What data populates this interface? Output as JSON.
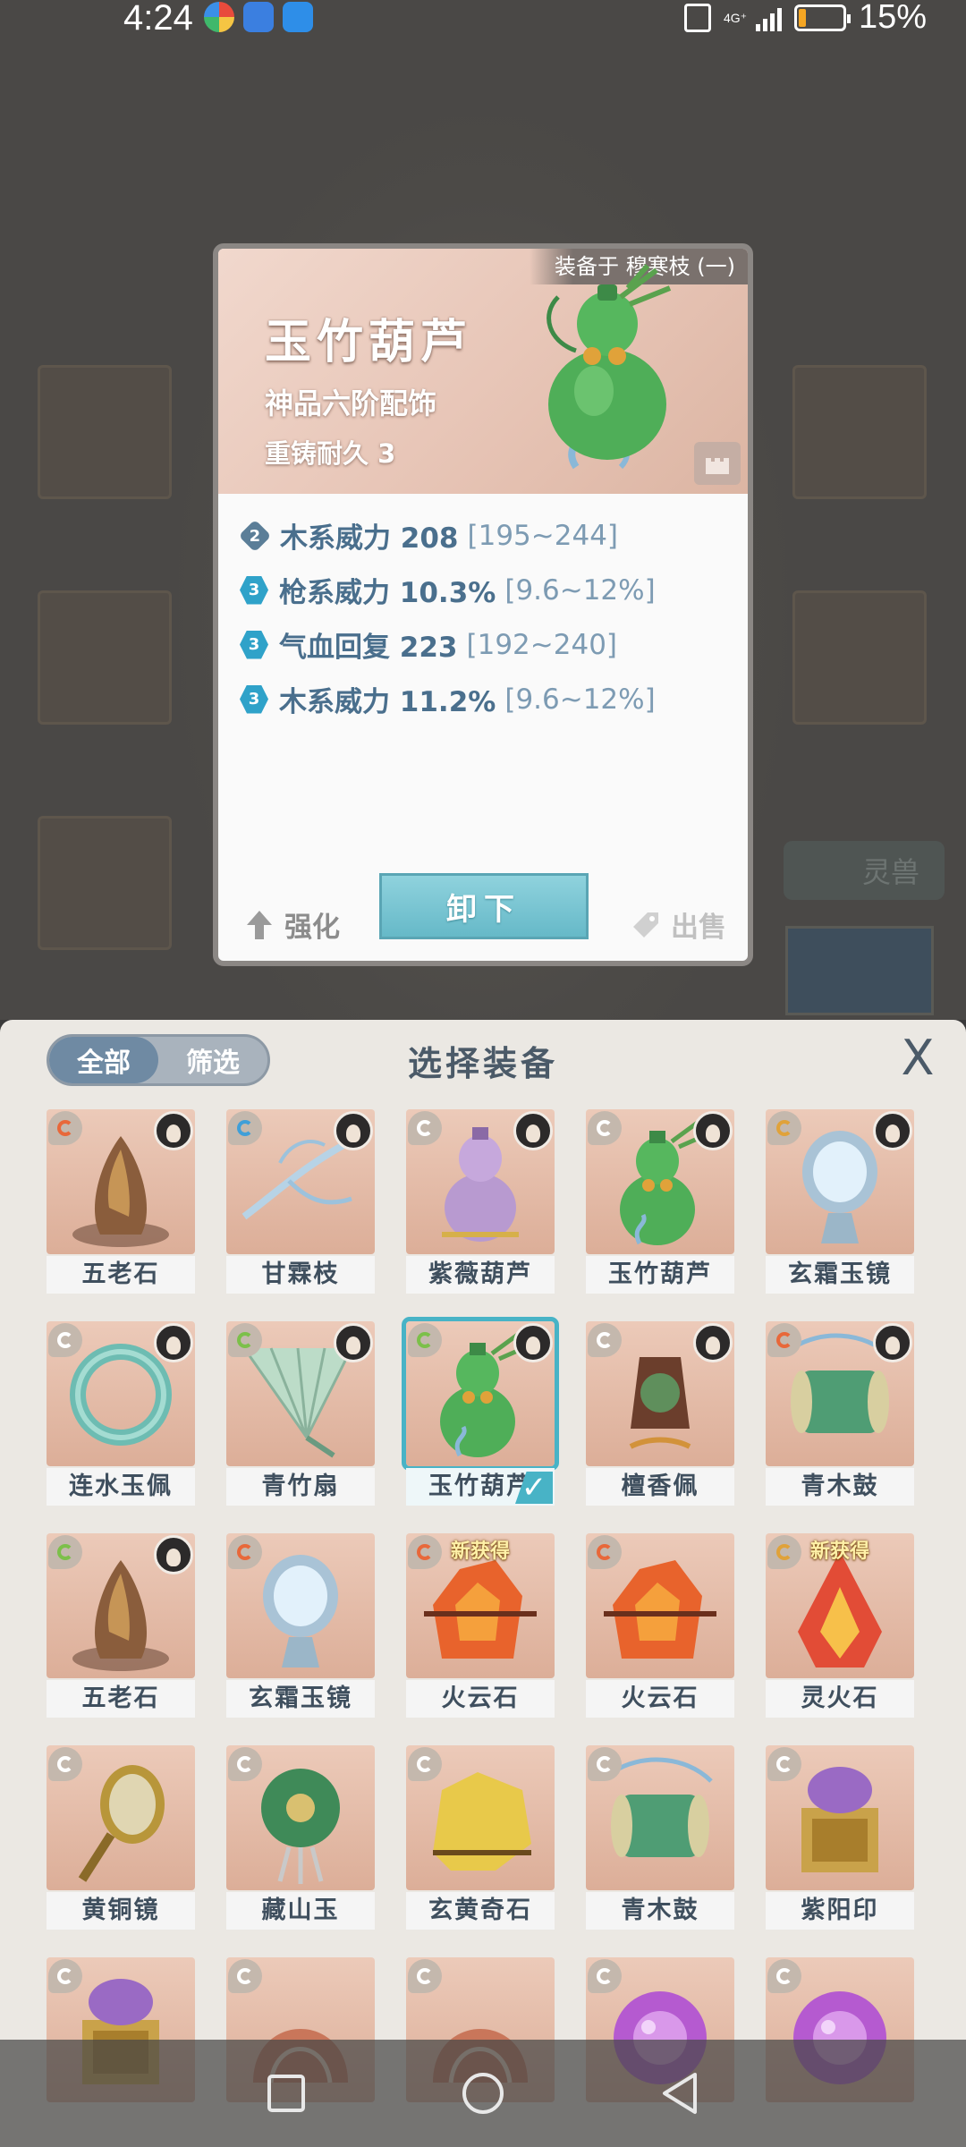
{
  "status_bar": {
    "time": "4:24",
    "battery_text": "15%",
    "network": "4G⁺",
    "battery_level_percent": 15
  },
  "detail": {
    "equipped_on": "装备于 穆寒枝 (一)",
    "name": "玉竹葫芦",
    "grade": "神品六阶配饰",
    "durability": "重铸耐久 3",
    "stats": [
      {
        "tier": "2",
        "text": "木系威力 208",
        "range": "[195~244]"
      },
      {
        "tier": "3",
        "text": "枪系威力 10.3%",
        "range": "[9.6~12%]"
      },
      {
        "tier": "3",
        "text": "气血回复 223",
        "range": "[192~240]"
      },
      {
        "tier": "3",
        "text": "木系威力 11.2%",
        "range": "[9.6~12%]"
      }
    ],
    "strengthen_label": "强化",
    "unequip_label": "卸下",
    "sell_label": "出售"
  },
  "background": {
    "spirit_beast_tab": "灵兽"
  },
  "panel": {
    "filter_all": "全部",
    "filter_screen": "筛选",
    "title": "选择装备",
    "close": "X",
    "items": [
      {
        "name": "五老石",
        "art": "stone-brown",
        "element": "fire",
        "owned": true,
        "new": ""
      },
      {
        "name": "甘霖枝",
        "art": "branch",
        "element": "water",
        "owned": true,
        "new": ""
      },
      {
        "name": "紫薇葫芦",
        "art": "gourd-purple",
        "element": "neutral",
        "owned": true,
        "new": ""
      },
      {
        "name": "玉竹葫芦",
        "art": "gourd-green",
        "element": "neutral",
        "owned": true,
        "new": ""
      },
      {
        "name": "玄霜玉镜",
        "art": "mirror",
        "element": "earth",
        "owned": true,
        "new": ""
      },
      {
        "name": "连水玉佩",
        "art": "jade-ring",
        "element": "neutral",
        "owned": true,
        "new": ""
      },
      {
        "name": "青竹扇",
        "art": "fan",
        "element": "wood",
        "owned": true,
        "new": ""
      },
      {
        "name": "玉竹葫芦",
        "art": "gourd-green",
        "element": "wood",
        "owned": true,
        "new": "",
        "selected": true
      },
      {
        "name": "檀香佩",
        "art": "pendant",
        "element": "neutral",
        "owned": true,
        "new": ""
      },
      {
        "name": "青木鼓",
        "art": "drum",
        "element": "fire",
        "owned": true,
        "new": ""
      },
      {
        "name": "五老石",
        "art": "stone-brown",
        "element": "wood",
        "owned": true,
        "new": ""
      },
      {
        "name": "玄霜玉镜",
        "art": "mirror",
        "element": "fire",
        "owned": false,
        "new": ""
      },
      {
        "name": "火云石",
        "art": "fire-stone",
        "element": "fire",
        "owned": false,
        "new": "新获得"
      },
      {
        "name": "火云石",
        "art": "fire-stone",
        "element": "fire",
        "owned": false,
        "new": ""
      },
      {
        "name": "灵火石",
        "art": "flame-crystal",
        "element": "earth",
        "owned": false,
        "new": "新获得"
      },
      {
        "name": "黄铜镜",
        "art": "bronze-mirror",
        "element": "neutral",
        "owned": false,
        "new": ""
      },
      {
        "name": "藏山玉",
        "art": "jade-disc",
        "element": "neutral",
        "owned": false,
        "new": ""
      },
      {
        "name": "玄黄奇石",
        "art": "yellow-rock",
        "element": "neutral",
        "owned": false,
        "new": ""
      },
      {
        "name": "青木鼓",
        "art": "drum",
        "element": "neutral",
        "owned": false,
        "new": ""
      },
      {
        "name": "紫阳印",
        "art": "seal",
        "element": "neutral",
        "owned": false,
        "new": ""
      },
      {
        "name": "",
        "art": "seal",
        "element": "neutral",
        "owned": false,
        "new": ""
      },
      {
        "name": "",
        "art": "shell",
        "element": "neutral",
        "owned": false,
        "new": ""
      },
      {
        "name": "",
        "art": "shell",
        "element": "neutral",
        "owned": false,
        "new": ""
      },
      {
        "name": "",
        "art": "purple-orb",
        "element": "neutral",
        "owned": false,
        "new": ""
      },
      {
        "name": "",
        "art": "purple-orb",
        "element": "neutral",
        "owned": false,
        "new": ""
      }
    ]
  },
  "colors": {
    "accent_teal": "#48b3c6",
    "stat_text": "#4a6f8d",
    "panel_title": "#4b5a68",
    "tile_bg": "#dcae98"
  },
  "icons": {
    "nav_recent": "square-icon",
    "nav_home": "circle-icon",
    "nav_back": "triangle-back-icon"
  }
}
